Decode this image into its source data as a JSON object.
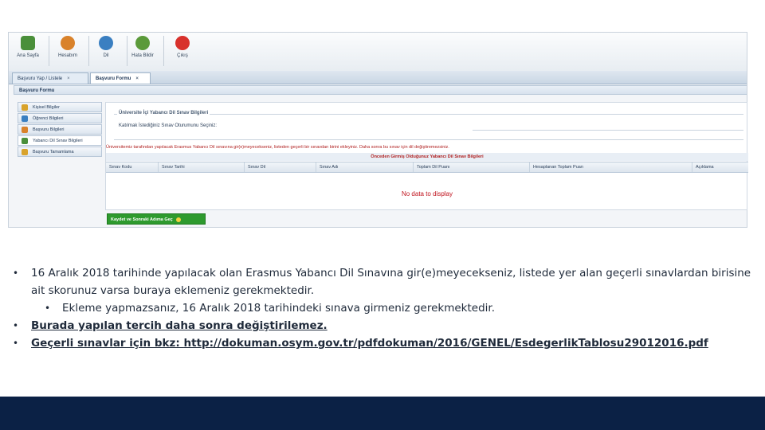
{
  "toolbar": {
    "buttons": [
      {
        "label": "Ana Sayfa",
        "icon": "home-icon",
        "color": "#4a8f3a"
      },
      {
        "label": "Hesabım",
        "icon": "user-icon",
        "color": "#d9822b"
      },
      {
        "label": "Dil",
        "icon": "globe-icon",
        "color": "#3a7fc1"
      },
      {
        "label": "Hata Bildir",
        "icon": "bug-icon",
        "color": "#5b9a3a"
      },
      {
        "label": "Çıkış",
        "icon": "exit-icon",
        "color": "#d8312c"
      }
    ]
  },
  "tabs": [
    {
      "label": "Başvuru Yap / Listele",
      "close": "×"
    },
    {
      "label": "Başvuru Formu",
      "close": "×"
    }
  ],
  "panel": {
    "title": "Başvuru Formu"
  },
  "nav": {
    "items": [
      {
        "label": "Kişisel Bilgiler",
        "color": "#d9a32b"
      },
      {
        "label": "Öğrenci Bilgileri",
        "color": "#3a7fc1"
      },
      {
        "label": "Başvuru Bilgileri",
        "color": "#d9822b"
      },
      {
        "label": "Yabancı Dil Sınav Bilgileri",
        "color": "#4a8f3a"
      },
      {
        "label": "Başvuru Tamamlama",
        "color": "#d9a32b"
      }
    ]
  },
  "form": {
    "fieldset_legend": "Üniversite İçi Yabancı Dil Sınav Bilgileri",
    "field_label": "Katılmak İstediğiniz Sınav Oturumunu Seçiniz:",
    "info_text": "Üniversitemiz tarafından yapılacak Erasmus Yabancı Dil sınavına gir(e)meyecekseniz, listeden geçerli bir sınavdan birini ekleyiniz. Daha sonra bu sınav için dil değiştiremezsiniz.",
    "grid_title": "Önceden Girmiş Olduğunuz Yabancı Dil Sınav Bilgileri",
    "columns": [
      "Sınav Kodu",
      "Sınav Tarihi",
      "Sınav Dil",
      "Sınav Adı",
      "Toplam Dil Puanı",
      "Hesaplanan Toplam Puan",
      "Açıklama"
    ],
    "no_data": "No data to display",
    "save_button": "Kaydet ve Sonraki Adıma Geç"
  },
  "bullets": {
    "b1": "16 Aralık 2018 tarihinde yapılacak olan Erasmus Yabancı Dil Sınavına gir(e)meyecekseniz, listede yer alan geçerli sınavlardan birisine ait skorunuz varsa buraya eklemeniz gerekmektedir.",
    "b1_sub": "Ekleme yapmazsanız, 16 Aralık 2018 tarihindeki sınava girmeniz gerekmektedir.",
    "b2": "Burada yapılan tercih daha sonra değiştirilemez.",
    "b3_prefix": "Geçerli sınavlar için bkz: ",
    "b3_link": "http://dokuman.osym.gov.tr/pdfdokuman/2016/GENEL/EsdegerlikTablosu29012016.pdf"
  },
  "colors": {
    "footer": "#0b2145",
    "accent_line": "#c4a64c",
    "error_text": "#c0141e",
    "save_button": "#2e9a2e"
  }
}
